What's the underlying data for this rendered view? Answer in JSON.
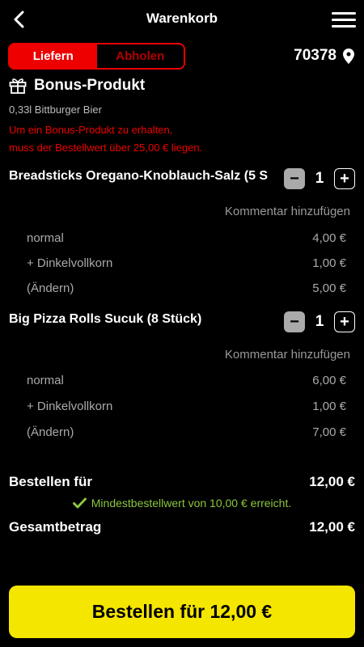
{
  "header": {
    "title": "Warenkorb",
    "back_icon": "chevron-left-icon",
    "menu_icon": "hamburger-menu-icon"
  },
  "delivery": {
    "options": [
      "Liefern",
      "Abholen"
    ],
    "selected": "Liefern",
    "postal_code": "70378",
    "location_icon": "map-pin-icon"
  },
  "bonus": {
    "icon": "gift-icon",
    "title": "Bonus-Produkt",
    "product": "0,33l Bittburger Bier",
    "warning_line1": "Um ein Bonus-Produkt zu erhalten,",
    "warning_line2": "muss der Bestellwert über 25,00 € liegen."
  },
  "items": [
    {
      "name": "Breadsticks Oregano-Knoblauch-Salz (5 S",
      "quantity": "1",
      "comment_label": "Kommentar hinzufügen",
      "options": [
        {
          "label": "normal",
          "price": "4,00 €"
        },
        {
          "label": "+ Dinkelvollkorn",
          "price": "1,00 €"
        },
        {
          "label": "(Ändern)",
          "price": "5,00 €"
        }
      ]
    },
    {
      "name": "Big Pizza Rolls Sucuk (8 Stück)",
      "quantity": "1",
      "comment_label": "Kommentar hinzufügen",
      "options": [
        {
          "label": "normal",
          "price": "6,00 €"
        },
        {
          "label": "+ Dinkelvollkorn",
          "price": "1,00 €"
        },
        {
          "label": "(Ändern)",
          "price": "7,00 €"
        }
      ]
    }
  ],
  "summary": {
    "order_for_label": "Bestellen für",
    "order_for_value": "12,00 €",
    "min_order_msg": "Mindestbestellwert von 10,00 € erreicht.",
    "total_label": "Gesamtbetrag",
    "total_value": "12,00 €"
  },
  "cta": {
    "label": "Bestellen für 12,00 €"
  },
  "colors": {
    "accent_red": "#ee0000",
    "cta_yellow": "#f5e600",
    "success_green": "#8cc63f"
  }
}
